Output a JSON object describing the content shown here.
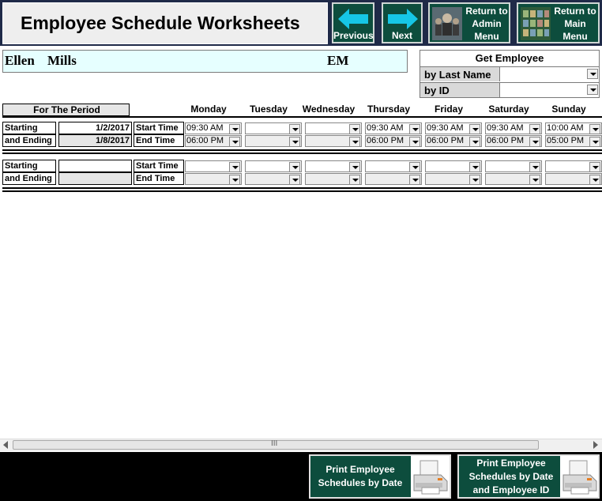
{
  "header": {
    "title": "Employee Schedule Worksheets",
    "previous_label": "Previous",
    "next_label": "Next",
    "admin_label": [
      "Return to",
      "Admin",
      "Menu"
    ],
    "main_label": [
      "Return to",
      "Main",
      "Menu"
    ],
    "arrow_color": "#16c6e6",
    "button_color": "#0d4d3d"
  },
  "employee": {
    "first_name": "Ellen",
    "last_name": "Mills",
    "initials": "EM"
  },
  "get_employee": {
    "title": "Get Employee",
    "by_last_name": "by Last Name",
    "by_id": "by ID",
    "last_name_value": "",
    "id_value": ""
  },
  "period_header": "For The Period",
  "days": [
    "Monday",
    "Tuesday",
    "Wednesday",
    "Thursday",
    "Friday",
    "Saturday",
    "Sunday"
  ],
  "labels": {
    "starting": "Starting",
    "ending": "and Ending",
    "start_time": "Start Time",
    "end_time": "End Time"
  },
  "periods": [
    {
      "start_date": "1/2/2017",
      "end_date": "1/8/2017",
      "start_times": [
        "09:30 AM",
        "",
        "",
        "09:30 AM",
        "09:30 AM",
        "09:30 AM",
        "10:00 AM"
      ],
      "end_times": [
        "06:00 PM",
        "",
        "",
        "06:00 PM",
        "06:00 PM",
        "06:00 PM",
        "05:00 PM"
      ]
    },
    {
      "start_date": "",
      "end_date": "",
      "start_times": [
        "",
        "",
        "",
        "",
        "",
        "",
        ""
      ],
      "end_times": [
        "",
        "",
        "",
        "",
        "",
        "",
        ""
      ]
    }
  ],
  "footer": {
    "print_by_date": [
      "Print Employee",
      "Schedules by Date"
    ],
    "print_by_date_id": [
      "Print Employee",
      "Schedules by Date",
      "and Employee ID"
    ],
    "printer_icon": "printer-icon"
  },
  "scrollbar_grip": "III"
}
